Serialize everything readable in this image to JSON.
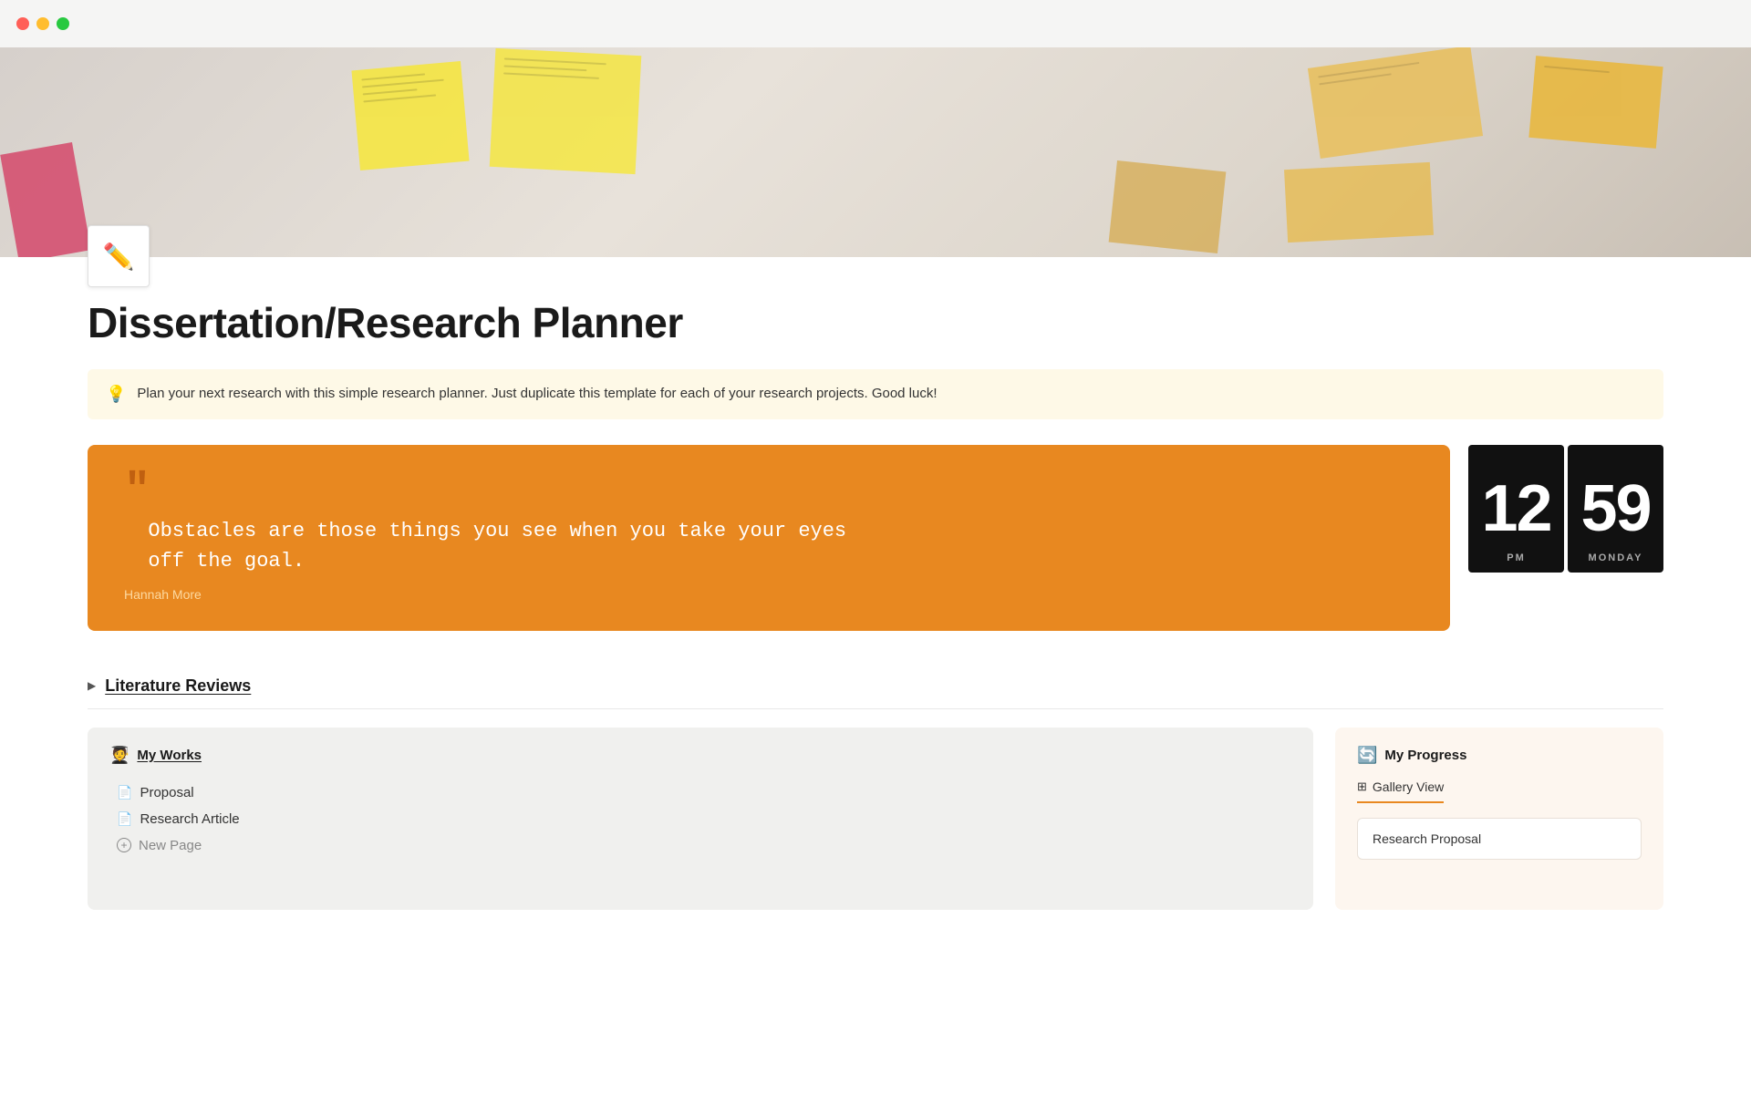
{
  "titlebar": {
    "traffic_lights": [
      "red",
      "yellow",
      "green"
    ]
  },
  "hero": {
    "alt": "Sticky notes on wall background"
  },
  "page": {
    "icon_emoji": "📝",
    "title": "Dissertation/Research Planner",
    "callout": {
      "icon": "💡",
      "text": "Plan your next research with this simple research planner. Just duplicate this template for each of your research projects. Good luck!"
    }
  },
  "quote": {
    "marks": "❝",
    "text": "  Obstacles are those things you see when you take your eyes\n  off the goal.",
    "author": "Hannah More"
  },
  "clock": {
    "hour": "12",
    "minute": "59",
    "period": "PM",
    "day": "MONDAY"
  },
  "sections": [
    {
      "id": "literature-reviews",
      "label": "Literature Reviews"
    }
  ],
  "my_works": {
    "header_icon": "🧑‍🎓",
    "header_label": "My Works",
    "items": [
      {
        "id": "proposal",
        "icon": "📄",
        "label": "Proposal"
      },
      {
        "id": "research-article",
        "icon": "📄",
        "label": "Research Article"
      }
    ],
    "new_page_label": "New Page"
  },
  "my_progress": {
    "header_icon": "🔄",
    "header_label": "My Progress",
    "tab_label": "Gallery View",
    "tab_icon": "⊞",
    "card_label": "Research Proposal"
  },
  "colors": {
    "orange_accent": "#e88820",
    "panel_bg": "#f0f0ee",
    "progress_bg": "#fdf6ef"
  }
}
